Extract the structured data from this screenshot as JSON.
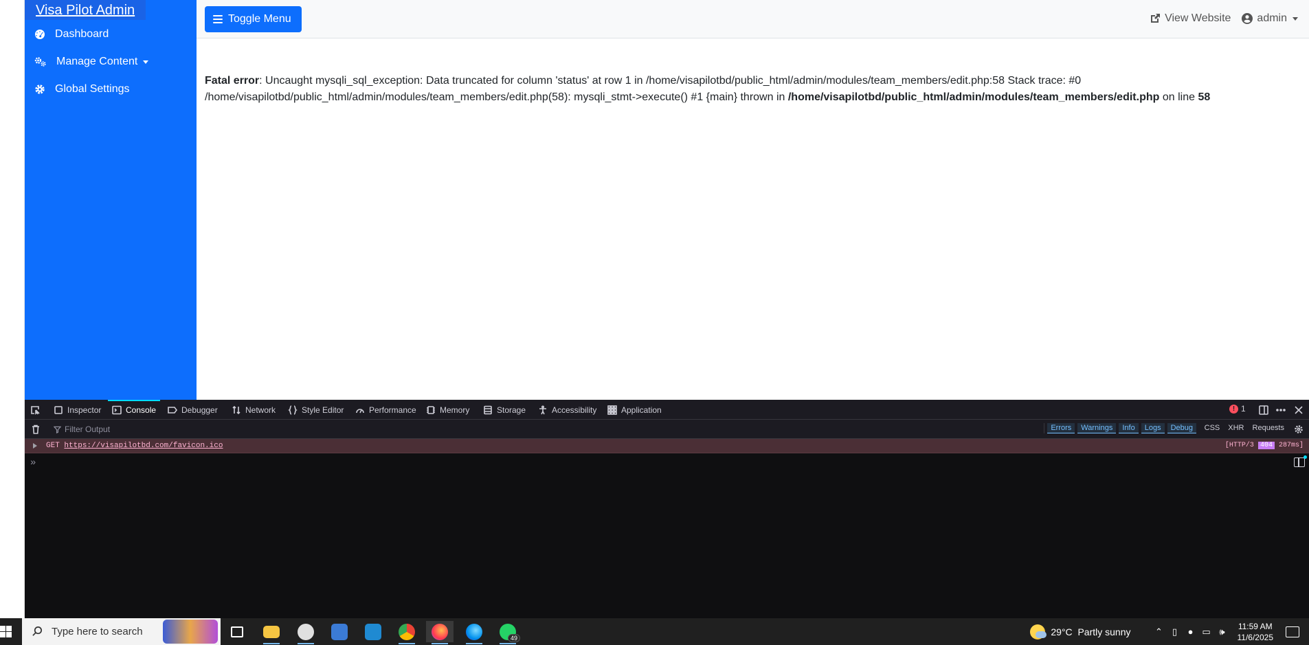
{
  "sidebar": {
    "brand": "Visa Pilot Admin",
    "items": [
      {
        "label": "Dashboard",
        "icon": "dashboard-gauge-icon"
      },
      {
        "label": "Manage Content",
        "icon": "cogs-icon",
        "has_dropdown": true
      },
      {
        "label": "Global Settings",
        "icon": "gear-icon"
      }
    ],
    "color": "#0d6efd"
  },
  "topbar": {
    "toggle_label": "Toggle Menu",
    "view_website_label": "View Website",
    "user_label": "admin"
  },
  "error": {
    "heading": "Fatal error",
    "message_1": ": Uncaught mysqli_sql_exception: Data truncated for column 'status' at row 1 in /home/visapilotbd/public_html/admin/modules/team_members/edit.php:58 Stack trace: #0 /home/visapilotbd/public_html/admin/modules/team_members/edit.php(58): mysqli_stmt->execute() #1 {main} thrown in ",
    "file": "/home/visapilotbd/public_html/admin/modules/team_members/edit.php",
    "message_2": " on line ",
    "line": "58"
  },
  "devtools": {
    "tabs": [
      "Inspector",
      "Console",
      "Debugger",
      "Network",
      "Style Editor",
      "Performance",
      "Memory",
      "Storage",
      "Accessibility",
      "Application"
    ],
    "active_tab": "Console",
    "error_count": "1",
    "filter_placeholder": "Filter Output",
    "filters": [
      "Errors",
      "Warnings",
      "Info",
      "Logs",
      "Debug"
    ],
    "categories": [
      "CSS",
      "XHR",
      "Requests"
    ],
    "log": {
      "method": "GET",
      "url": "https://visapilotbd.com/favicon.ico",
      "protocol": "[HTTP/3",
      "status": "404",
      "time": "287ms]"
    },
    "prompt": "»"
  },
  "taskbar": {
    "search_placeholder": "Type here to search",
    "whatsapp_badge": "49",
    "weather_temp": "29°C",
    "weather_desc": "Partly sunny",
    "time": "11:59 AM",
    "date": "11/6/2025"
  }
}
